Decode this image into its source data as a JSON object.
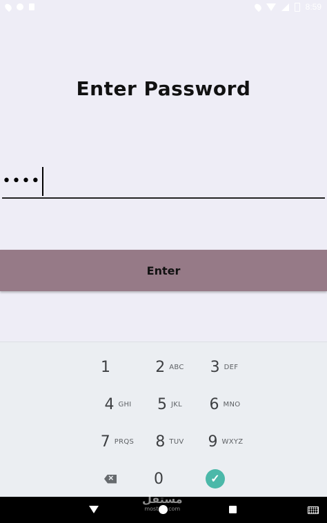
{
  "status_bar": {
    "time": "8:59",
    "left_icons": [
      "location-icon",
      "sync-icon",
      "sd-card-icon"
    ],
    "right_icons": [
      "location-icon",
      "wifi-icon",
      "cellular-icon",
      "battery-icon"
    ]
  },
  "page": {
    "title": "Enter Password",
    "password_value": "••••",
    "enter_label": "Enter",
    "enter_color": "#967a87"
  },
  "keyboard": {
    "keys": [
      {
        "num": "1",
        "sub": ""
      },
      {
        "num": "2",
        "sub": "ABC"
      },
      {
        "num": "3",
        "sub": "DEF"
      },
      {
        "num": "4",
        "sub": "GHI"
      },
      {
        "num": "5",
        "sub": "JKL"
      },
      {
        "num": "6",
        "sub": "MNO"
      },
      {
        "num": "7",
        "sub": "PRQS"
      },
      {
        "num": "8",
        "sub": "TUV"
      },
      {
        "num": "9",
        "sub": "WXYZ"
      },
      {
        "num": "0",
        "sub": ""
      }
    ],
    "done_color": "#4bb8a9"
  },
  "watermark": {
    "main": "مستقل",
    "sub": "mostaql.com"
  }
}
